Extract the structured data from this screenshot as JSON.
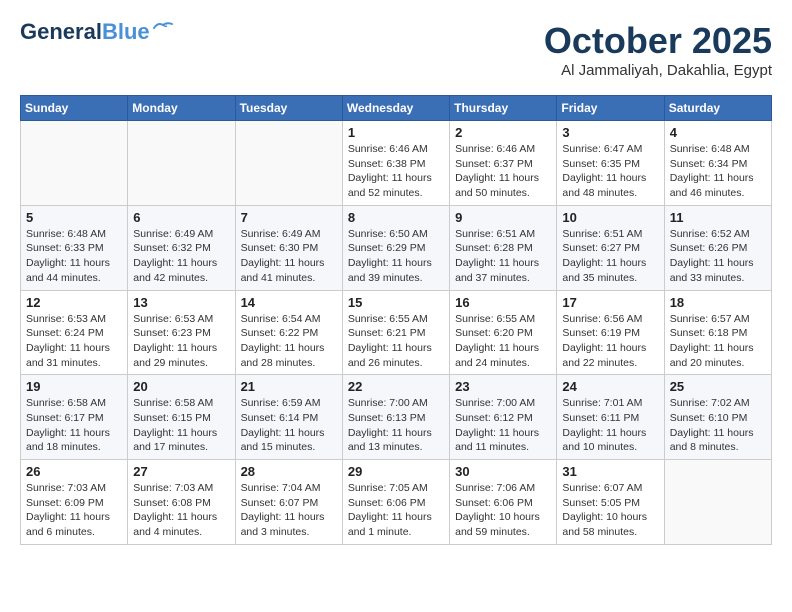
{
  "header": {
    "logo_line1": "General",
    "logo_line2": "Blue",
    "month": "October 2025",
    "location": "Al Jammaliyah, Dakahlia, Egypt"
  },
  "weekdays": [
    "Sunday",
    "Monday",
    "Tuesday",
    "Wednesday",
    "Thursday",
    "Friday",
    "Saturday"
  ],
  "weeks": [
    [
      {
        "day": "",
        "info": ""
      },
      {
        "day": "",
        "info": ""
      },
      {
        "day": "",
        "info": ""
      },
      {
        "day": "1",
        "info": "Sunrise: 6:46 AM\nSunset: 6:38 PM\nDaylight: 11 hours\nand 52 minutes."
      },
      {
        "day": "2",
        "info": "Sunrise: 6:46 AM\nSunset: 6:37 PM\nDaylight: 11 hours\nand 50 minutes."
      },
      {
        "day": "3",
        "info": "Sunrise: 6:47 AM\nSunset: 6:35 PM\nDaylight: 11 hours\nand 48 minutes."
      },
      {
        "day": "4",
        "info": "Sunrise: 6:48 AM\nSunset: 6:34 PM\nDaylight: 11 hours\nand 46 minutes."
      }
    ],
    [
      {
        "day": "5",
        "info": "Sunrise: 6:48 AM\nSunset: 6:33 PM\nDaylight: 11 hours\nand 44 minutes."
      },
      {
        "day": "6",
        "info": "Sunrise: 6:49 AM\nSunset: 6:32 PM\nDaylight: 11 hours\nand 42 minutes."
      },
      {
        "day": "7",
        "info": "Sunrise: 6:49 AM\nSunset: 6:30 PM\nDaylight: 11 hours\nand 41 minutes."
      },
      {
        "day": "8",
        "info": "Sunrise: 6:50 AM\nSunset: 6:29 PM\nDaylight: 11 hours\nand 39 minutes."
      },
      {
        "day": "9",
        "info": "Sunrise: 6:51 AM\nSunset: 6:28 PM\nDaylight: 11 hours\nand 37 minutes."
      },
      {
        "day": "10",
        "info": "Sunrise: 6:51 AM\nSunset: 6:27 PM\nDaylight: 11 hours\nand 35 minutes."
      },
      {
        "day": "11",
        "info": "Sunrise: 6:52 AM\nSunset: 6:26 PM\nDaylight: 11 hours\nand 33 minutes."
      }
    ],
    [
      {
        "day": "12",
        "info": "Sunrise: 6:53 AM\nSunset: 6:24 PM\nDaylight: 11 hours\nand 31 minutes."
      },
      {
        "day": "13",
        "info": "Sunrise: 6:53 AM\nSunset: 6:23 PM\nDaylight: 11 hours\nand 29 minutes."
      },
      {
        "day": "14",
        "info": "Sunrise: 6:54 AM\nSunset: 6:22 PM\nDaylight: 11 hours\nand 28 minutes."
      },
      {
        "day": "15",
        "info": "Sunrise: 6:55 AM\nSunset: 6:21 PM\nDaylight: 11 hours\nand 26 minutes."
      },
      {
        "day": "16",
        "info": "Sunrise: 6:55 AM\nSunset: 6:20 PM\nDaylight: 11 hours\nand 24 minutes."
      },
      {
        "day": "17",
        "info": "Sunrise: 6:56 AM\nSunset: 6:19 PM\nDaylight: 11 hours\nand 22 minutes."
      },
      {
        "day": "18",
        "info": "Sunrise: 6:57 AM\nSunset: 6:18 PM\nDaylight: 11 hours\nand 20 minutes."
      }
    ],
    [
      {
        "day": "19",
        "info": "Sunrise: 6:58 AM\nSunset: 6:17 PM\nDaylight: 11 hours\nand 18 minutes."
      },
      {
        "day": "20",
        "info": "Sunrise: 6:58 AM\nSunset: 6:15 PM\nDaylight: 11 hours\nand 17 minutes."
      },
      {
        "day": "21",
        "info": "Sunrise: 6:59 AM\nSunset: 6:14 PM\nDaylight: 11 hours\nand 15 minutes."
      },
      {
        "day": "22",
        "info": "Sunrise: 7:00 AM\nSunset: 6:13 PM\nDaylight: 11 hours\nand 13 minutes."
      },
      {
        "day": "23",
        "info": "Sunrise: 7:00 AM\nSunset: 6:12 PM\nDaylight: 11 hours\nand 11 minutes."
      },
      {
        "day": "24",
        "info": "Sunrise: 7:01 AM\nSunset: 6:11 PM\nDaylight: 11 hours\nand 10 minutes."
      },
      {
        "day": "25",
        "info": "Sunrise: 7:02 AM\nSunset: 6:10 PM\nDaylight: 11 hours\nand 8 minutes."
      }
    ],
    [
      {
        "day": "26",
        "info": "Sunrise: 7:03 AM\nSunset: 6:09 PM\nDaylight: 11 hours\nand 6 minutes."
      },
      {
        "day": "27",
        "info": "Sunrise: 7:03 AM\nSunset: 6:08 PM\nDaylight: 11 hours\nand 4 minutes."
      },
      {
        "day": "28",
        "info": "Sunrise: 7:04 AM\nSunset: 6:07 PM\nDaylight: 11 hours\nand 3 minutes."
      },
      {
        "day": "29",
        "info": "Sunrise: 7:05 AM\nSunset: 6:06 PM\nDaylight: 11 hours\nand 1 minute."
      },
      {
        "day": "30",
        "info": "Sunrise: 7:06 AM\nSunset: 6:06 PM\nDaylight: 10 hours\nand 59 minutes."
      },
      {
        "day": "31",
        "info": "Sunrise: 6:07 AM\nSunset: 5:05 PM\nDaylight: 10 hours\nand 58 minutes."
      },
      {
        "day": "",
        "info": ""
      }
    ]
  ]
}
